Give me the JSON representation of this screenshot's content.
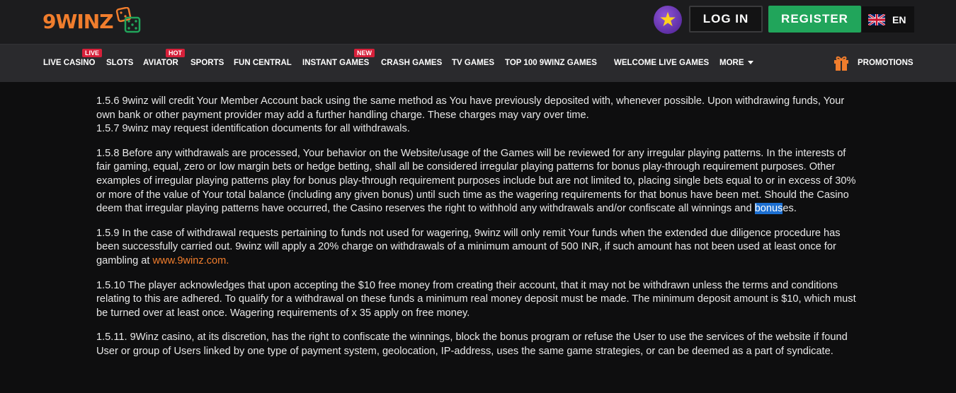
{
  "header": {
    "logo_text": "9WINZ",
    "login_label": "LOG IN",
    "register_label": "REGISTER",
    "language": "EN",
    "star_icon": "star-icon",
    "flag_icon": "uk-flag-icon"
  },
  "nav": {
    "items": [
      {
        "label": "LIVE CASINO",
        "badge": "LIVE"
      },
      {
        "label": "SLOTS",
        "badge": ""
      },
      {
        "label": "AVIATOR",
        "badge": "HOT"
      },
      {
        "label": "SPORTS",
        "badge": ""
      },
      {
        "label": "FUN CENTRAL",
        "badge": ""
      },
      {
        "label": "INSTANT GAMES",
        "badge": "NEW"
      },
      {
        "label": "CRASH GAMES",
        "badge": ""
      },
      {
        "label": "TV GAMES",
        "badge": ""
      },
      {
        "label": "TOP 100 9WINZ GAMES",
        "badge": ""
      },
      {
        "label": "WELCOME LIVE GAMES",
        "badge": ""
      },
      {
        "label": "MORE",
        "badge": ""
      }
    ],
    "promotions_label": "PROMOTIONS"
  },
  "colors": {
    "brand_orange": "#f07d2d",
    "register_green": "#21a55b",
    "badge_red": "#d7203a",
    "selection_blue": "#1c6fd1"
  },
  "terms": {
    "p1": "1.5.6 9winz will credit Your Member Account back using the same method as You have previously deposited with, whenever possible. Upon withdrawing funds, Your own bank or other payment provider may add a further handling charge. These charges may vary over time.",
    "p1b": "1.5.7 9winz may request identification documents for all withdrawals.",
    "p2_pre": "1.5.8 Before any withdrawals are processed, Your behavior on the Website/usage of the Games will be reviewed for any irregular playing patterns. In the interests of fair gaming, equal, zero or low margin bets or hedge betting, shall all be considered irregular playing patterns for bonus play-through requirement purposes. Other examples of irregular playing patterns play for bonus play-through requirement purposes include but are not limited to, placing single bets equal to or in excess of 30% or more of the value of Your total balance (including any given bonus) until such time as the wagering requirements for that bonus have been met. Should the Casino deem that irregular playing patterns have occurred, the Casino reserves the right to withhold any withdrawals and/or confiscate all winnings and ",
    "p2_highlight": "bonus",
    "p2_post": "es.",
    "p3_pre": "1.5.9 In the case of withdrawal requests pertaining to funds not used for wagering, 9winz will only remit Your funds when the extended due diligence procedure has been successfully carried out. 9winz will apply a 20% charge on withdrawals of a minimum amount of 500 INR, if such amount has not been used at least once for gambling at ",
    "p3_link": "www.9winz.com.",
    "p4": "1.5.10 The player acknowledges that upon accepting the $10 free money from creating their account, that it may not be withdrawn unless the terms and conditions relating to this are adhered. To qualify for a withdrawal on these funds a minimum real money deposit must be made. The minimum deposit amount is $10, which must be turned over at least once. Wagering requirements of x 35 apply on free money.",
    "p5": "1.5.11. 9Winz casino, at its discretion, has the right to confiscate the winnings, block the bonus program or refuse the User to use the services of the website if found User or group of Users linked by one type of payment system, geolocation, IP-address, uses the same game strategies, or can be deemed as a part of syndicate."
  }
}
